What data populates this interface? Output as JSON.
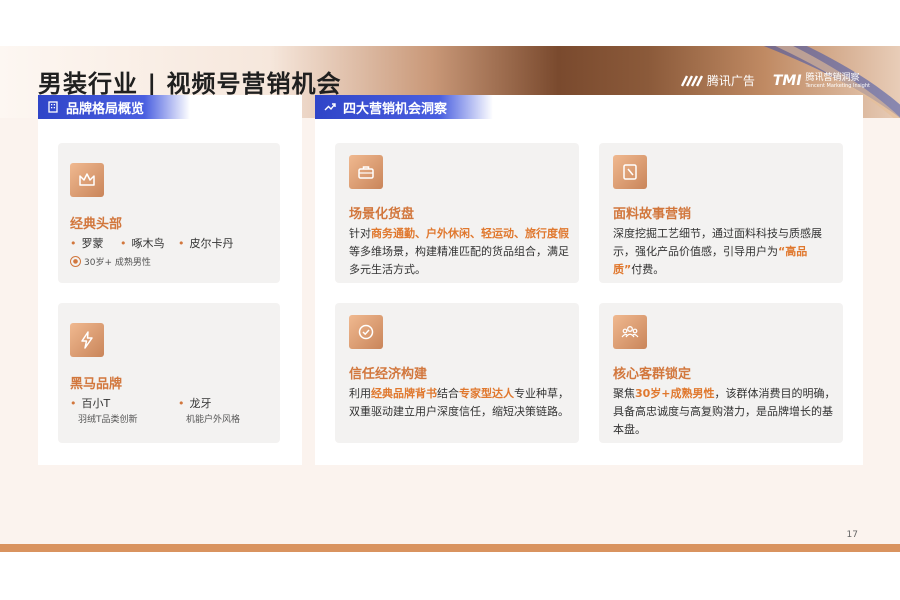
{
  "header": {
    "title": "男装行业 | 视频号营销机会",
    "logo_tencent_ads": "腾讯广告",
    "logo_tmi_mark": "TMI",
    "logo_tmi_text": "腾讯营销洞察",
    "logo_tmi_sub": "Tencent Marketing Insight"
  },
  "left_panel": {
    "tab_label": "品牌格局概览",
    "cards": [
      {
        "title": "经典头部",
        "brands": [
          "罗蒙",
          "啄木鸟",
          "皮尔卡丹"
        ],
        "audience": "30岁+ 成熟男性"
      },
      {
        "title": "黑马品牌",
        "brands": [
          {
            "name": "百小T",
            "sub": "羽绒T品类创新"
          },
          {
            "name": "龙牙",
            "sub": "机能户外风格"
          }
        ]
      }
    ]
  },
  "right_panel": {
    "tab_label": "四大营销机会洞察",
    "cards": [
      {
        "title": "场景化货盘",
        "pre": "针对",
        "hl": "商务通勤、户外休闲、轻运动、旅行度假",
        "post": "等多维场景，构建精准匹配的货品组合，满足多元生活方式。"
      },
      {
        "title": "面料故事营销",
        "pre": "深度挖掘工艺细节，通过面料科技与质感展示，强化产品价值感，引导用户为",
        "hl": "“高品质”",
        "post": "付费。"
      },
      {
        "title": "信任经济构建",
        "pre": "利用",
        "hl": "经典品牌背书",
        "mid": "结合",
        "hl2": "专家型达人",
        "post": "专业种草，双重驱动建立用户深度信任，缩短决策链路。"
      },
      {
        "title": "核心客群锁定",
        "pre": "聚焦",
        "hl": "30岁+成熟男性",
        "post": "，该群体消费目的明确，具备高忠诚度与高复购潜力，是品牌增长的基本盘。"
      }
    ]
  },
  "footer": {
    "page_number": "17"
  },
  "colors": {
    "accent_orange": "#d2773d",
    "tab_blue": "#2f45c8",
    "bottom_bar": "#d9935f"
  }
}
